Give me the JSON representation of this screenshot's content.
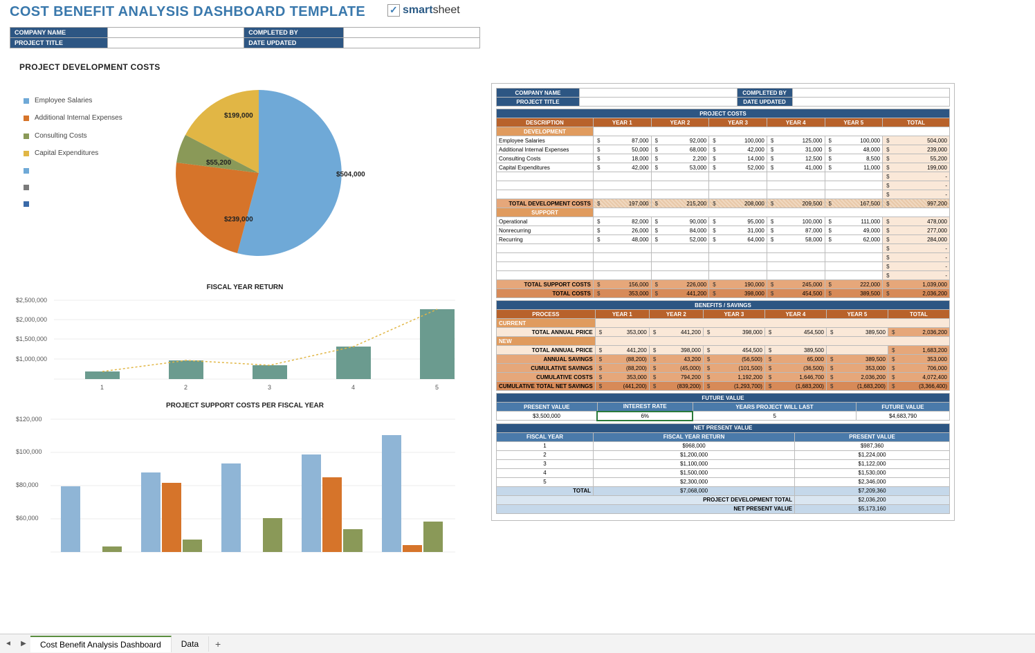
{
  "title": "COST BENEFIT ANALYSIS DASHBOARD TEMPLATE",
  "brand": "smartsheet",
  "info_left": {
    "company_name_label": "COMPANY NAME",
    "project_title_label": "PROJECT TITLE",
    "completed_by_label": "COMPLETED BY",
    "date_updated_label": "DATE UPDATED"
  },
  "sections": {
    "pdc": "PROJECT DEVELOPMENT COSTS",
    "fyr": "FISCAL YEAR RETURN",
    "psc": "PROJECT SUPPORT COSTS PER FISCAL YEAR"
  },
  "legend": [
    {
      "name": "Employee Salaries",
      "color": "#6fa9d7"
    },
    {
      "name": "Additional Internal Expenses",
      "color": "#d6742a"
    },
    {
      "name": "Consulting Costs",
      "color": "#8a9958"
    },
    {
      "name": "Capital Expenditures",
      "color": "#e1b645"
    },
    {
      "name": "",
      "color": "#6fa9d7"
    },
    {
      "name": "",
      "color": "#7a7a7a"
    },
    {
      "name": "",
      "color": "#3a6aa8"
    }
  ],
  "pie_labels": {
    "a": "$504,000",
    "b": "$239,000",
    "c": "$55,200",
    "d": "$199,000"
  },
  "right": {
    "hdr": {
      "company": "COMPANY NAME",
      "project": "PROJECT TITLE",
      "completed": "COMPLETED BY",
      "date": "DATE UPDATED"
    },
    "project_costs": "PROJECT COSTS",
    "col_desc": "DESCRIPTION",
    "years": [
      "YEAR 1",
      "YEAR 2",
      "YEAR 3",
      "YEAR 4",
      "YEAR 5"
    ],
    "total": "TOTAL",
    "development": "DEVELOPMENT",
    "dev_rows": [
      {
        "label": "Employee Salaries",
        "vals": [
          "87,000",
          "92,000",
          "100,000",
          "125,000",
          "100,000"
        ],
        "tot": "504,000"
      },
      {
        "label": "Additional Internal Expenses",
        "vals": [
          "50,000",
          "68,000",
          "42,000",
          "31,000",
          "48,000"
        ],
        "tot": "239,000"
      },
      {
        "label": "Consulting Costs",
        "vals": [
          "18,000",
          "2,200",
          "14,000",
          "12,500",
          "8,500"
        ],
        "tot": "55,200"
      },
      {
        "label": "Capital Expenditures",
        "vals": [
          "42,000",
          "53,000",
          "52,000",
          "41,000",
          "11,000"
        ],
        "tot": "199,000"
      }
    ],
    "tot_dev": "TOTAL DEVELOPMENT COSTS",
    "tot_dev_vals": [
      "197,000",
      "215,200",
      "208,000",
      "209,500",
      "167,500",
      "997,200"
    ],
    "support": "SUPPORT",
    "sup_rows": [
      {
        "label": "Operational",
        "vals": [
          "82,000",
          "90,000",
          "95,000",
          "100,000",
          "111,000"
        ],
        "tot": "478,000"
      },
      {
        "label": "Nonrecurring",
        "vals": [
          "26,000",
          "84,000",
          "31,000",
          "87,000",
          "49,000"
        ],
        "tot": "277,000"
      },
      {
        "label": "Recurring",
        "vals": [
          "48,000",
          "52,000",
          "64,000",
          "58,000",
          "62,000"
        ],
        "tot": "284,000"
      }
    ],
    "tot_sup": "TOTAL SUPPORT COSTS",
    "tot_sup_vals": [
      "156,000",
      "226,000",
      "190,000",
      "245,000",
      "222,000",
      "1,039,000"
    ],
    "tot_costs": "TOTAL COSTS",
    "tot_costs_vals": [
      "353,000",
      "441,200",
      "398,000",
      "454,500",
      "389,500",
      "2,036,200"
    ],
    "benefits": "BENEFITS / SAVINGS",
    "process": "PROCESS",
    "current": "CURRENT",
    "new": "NEW",
    "tap": "TOTAL ANNUAL PRICE",
    "tap_cur": [
      "353,000",
      "441,200",
      "398,000",
      "454,500",
      "389,500",
      "2,036,200"
    ],
    "tap_new": [
      "441,200",
      "398,000",
      "454,500",
      "389,500",
      "",
      "1,683,200"
    ],
    "as": "ANNUAL SAVINGS",
    "as_vals": [
      "(88,200)",
      "43,200",
      "(56,500)",
      "65,000",
      "389,500",
      "353,000"
    ],
    "cs": "CUMULATIVE SAVINGS",
    "cs_vals": [
      "(88,200)",
      "(45,000)",
      "(101,500)",
      "(36,500)",
      "353,000",
      "706,000"
    ],
    "cc": "CUMULATIVE COSTS",
    "cc_vals": [
      "353,000",
      "794,200",
      "1,192,200",
      "1,646,700",
      "2,036,200",
      "4,072,400"
    ],
    "ctns": "CUMULATIVE TOTAL NET SAVINGS",
    "ctns_vals": [
      "(441,200)",
      "(839,200)",
      "(1,293,700)",
      "(1,683,200)",
      "(1,683,200)",
      "(3,366,400)"
    ],
    "future_value": "FUTURE VALUE",
    "fv_cols": [
      "PRESENT VALUE",
      "INTEREST RATE",
      "YEARS PROJECT WILL LAST",
      "FUTURE VALUE"
    ],
    "fv_vals": [
      "$3,500,000",
      "6%",
      "5",
      "$4,683,790"
    ],
    "npv": "NET PRESENT VALUE",
    "npv_cols": [
      "FISCAL YEAR",
      "FISCAL YEAR RETURN",
      "PRESENT VALUE"
    ],
    "npv_rows": [
      [
        "1",
        "$968,000",
        "$987,360"
      ],
      [
        "2",
        "$1,200,000",
        "$1,224,000"
      ],
      [
        "3",
        "$1,100,000",
        "$1,122,000"
      ],
      [
        "4",
        "$1,500,000",
        "$1,530,000"
      ],
      [
        "5",
        "$2,300,000",
        "$2,346,000"
      ]
    ],
    "npv_total_label": "TOTAL",
    "npv_total": [
      "$7,068,000",
      "$7,209,360"
    ],
    "pdt": "PROJECT DEVELOPMENT TOTAL",
    "pdt_val": "$2,036,200",
    "npv_label": "NET PRESENT VALUE",
    "npv_val": "$5,173,160"
  },
  "chart_data": [
    {
      "type": "pie",
      "title": "PROJECT DEVELOPMENT COSTS",
      "series": [
        {
          "name": "Employee Salaries",
          "value": 504000,
          "color": "#6fa9d7"
        },
        {
          "name": "Additional Internal Expenses",
          "value": 239000,
          "color": "#d6742a"
        },
        {
          "name": "Consulting Costs",
          "value": 55200,
          "color": "#8a9958"
        },
        {
          "name": "Capital Expenditures",
          "value": 199000,
          "color": "#e1b645"
        }
      ]
    },
    {
      "type": "bar",
      "title": "FISCAL YEAR RETURN",
      "categories": [
        "1",
        "2",
        "3",
        "4",
        "5"
      ],
      "values": [
        968000,
        1200000,
        1100000,
        1500000,
        2300000
      ],
      "yticks": [
        "$2,500,000",
        "$2,000,000",
        "$1,500,000",
        "$1,000,000"
      ],
      "ylim": [
        800000,
        2500000
      ],
      "color": "#6b9b8f",
      "trend_color": "#e1b645"
    },
    {
      "type": "bar",
      "title": "PROJECT SUPPORT COSTS PER FISCAL YEAR",
      "categories": [
        "1",
        "2",
        "3",
        "4",
        "5"
      ],
      "series": [
        {
          "name": "Operational",
          "color": "#8fb5d6",
          "values": [
            82000,
            90000,
            95000,
            100000,
            111000
          ]
        },
        {
          "name": "Nonrecurring",
          "color": "#d6742a",
          "values": [
            26000,
            84000,
            31000,
            87000,
            49000
          ]
        },
        {
          "name": "Recurring",
          "color": "#8a9958",
          "values": [
            48000,
            52000,
            64000,
            58000,
            62000
          ]
        }
      ],
      "yticks": [
        "$120,000",
        "$100,000",
        "$80,000",
        "$60,000"
      ],
      "ylim": [
        45000,
        120000
      ]
    }
  ],
  "tabs": {
    "t1": "Cost Benefit Analysis Dashboard",
    "t2": "Data"
  }
}
